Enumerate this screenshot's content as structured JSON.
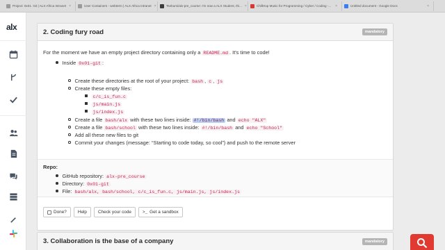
{
  "browser": {
    "tabs": [
      {
        "label": "Project: 0x01. Git | ALX Africa Intranet"
      },
      {
        "label": "User Containers - webterm | ALX Africa Intranet"
      },
      {
        "label": "Tsebumi/alx-pre_course: I'm now a ALX Student, thi..."
      },
      {
        "label": "ChillHop Music for Programming / Cyber / Coding -..."
      },
      {
        "label": "Untitled document - Google Docs"
      }
    ]
  },
  "sidebar": {
    "logo": "alx",
    "icons": [
      "calendar-icon",
      "fork-icon",
      "checkmark-icon",
      "users-icon",
      "document-icon",
      "chat-icon",
      "server-icon",
      "tools-icon",
      "slack-icon"
    ]
  },
  "task2": {
    "title": "2. Coding fury road",
    "badge": "mandatory",
    "intro_before": "For the moment we have an empty project directory containing only a",
    "intro_code": "README.md",
    "intro_after": ". It's time to code!",
    "inside_label": "Inside",
    "inside_code": "0x01-git",
    "inside_colon": ":",
    "dirs_text": "Create these directories at the root of your project:",
    "dirs": [
      "bash",
      "c",
      "js"
    ],
    "files_text": "Create these empty files:",
    "files": [
      "c/c_is_fun.c",
      "js/main.js",
      "js/index.js"
    ],
    "alx_pre": "Create a file",
    "alx_file": "bash/alx",
    "alx_mid": "with these two lines inside:",
    "alx_line1": "#!/bin/bash",
    "alx_and": "and",
    "alx_line2": "echo \"ALX\"",
    "school_pre": "Create a file",
    "school_file": "bash/school",
    "school_mid": "with these two lines inside:",
    "school_line1": "#!/bin/bash",
    "school_and": "and",
    "school_line2": "echo \"School\"",
    "add_text": "Add all these new files to git",
    "commit_text": "Commit your changes (message: “Starting to code today, so cool”) and push to the remote server",
    "repo": {
      "label": "Repo:",
      "github_label": "GitHub repository:",
      "github_value": "alx-pre_course",
      "dir_label": "Directory:",
      "dir_value": "0x01-git",
      "file_label": "File:",
      "file_value": "bash/alx, bash/school, c/c_is_fun.c, js/main.js, js/index.js"
    },
    "buttons": {
      "done": "Done?",
      "help": "Help",
      "check": "Check your code",
      "sandbox": "Get a sandbox"
    }
  },
  "task3": {
    "title": "3. Collaboration is the base of a company",
    "badge": "mandatory"
  },
  "colors": {
    "accent_red": "#e03a31",
    "code_red": "#c7254e"
  }
}
